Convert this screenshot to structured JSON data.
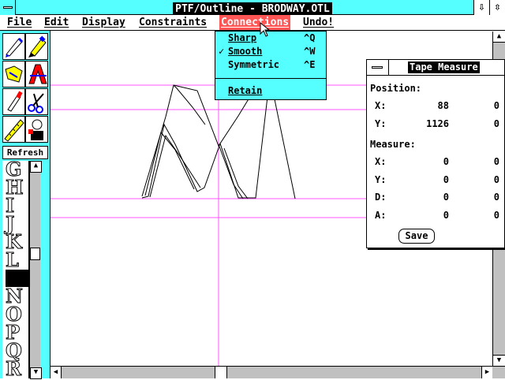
{
  "window": {
    "title": "PTF/Outline - BRODWAY.OTL",
    "minimize_icon": "down-arrow",
    "maximize_icon": "up-down-arrow"
  },
  "menubar": {
    "items": [
      "File",
      "Edit",
      "Display",
      "Constraints",
      "Connections",
      "Undo!"
    ],
    "active": "Connections"
  },
  "connections_menu": {
    "items": [
      {
        "label": "Sharp",
        "shortcut": "^Q",
        "checked": false
      },
      {
        "label": "Smooth",
        "shortcut": "^W",
        "checked": true
      },
      {
        "label": "Symmetric",
        "shortcut": "^E",
        "checked": false
      },
      {
        "label": "Retain",
        "shortcut": "",
        "checked": false
      }
    ],
    "check_mark": "✓"
  },
  "tools": [
    "pen-icon",
    "pencil-icon",
    "select-region-icon",
    "letter-a-icon",
    "knife-icon",
    "scissors-icon",
    "ruler-icon",
    "person-icon"
  ],
  "refresh_label": "Refresh",
  "glyph_list": [
    "G",
    "H",
    "I",
    "J",
    "K",
    "L",
    "M",
    "N",
    "O",
    "P",
    "Q",
    "R"
  ],
  "selected_glyph": "M",
  "tape_measure": {
    "title": "Tape Measure",
    "position_label": "Position:",
    "position": [
      {
        "axis": "X:",
        "a": "88",
        "b": "0"
      },
      {
        "axis": "Y:",
        "a": "1126",
        "b": "0"
      }
    ],
    "measure_label": "Measure:",
    "measure": [
      {
        "axis": "X:",
        "a": "0",
        "b": "0"
      },
      {
        "axis": "Y:",
        "a": "0",
        "b": "0"
      },
      {
        "axis": "D:",
        "a": "0",
        "b": "0"
      },
      {
        "axis": "A:",
        "a": "0",
        "b": "0"
      }
    ],
    "save_label": "Save"
  },
  "colors": {
    "title_bg": "#55ffff",
    "menu_highlight": "#ff5555",
    "guide_line": "#ff55ff",
    "scrollbar": "#c0c0c0"
  }
}
